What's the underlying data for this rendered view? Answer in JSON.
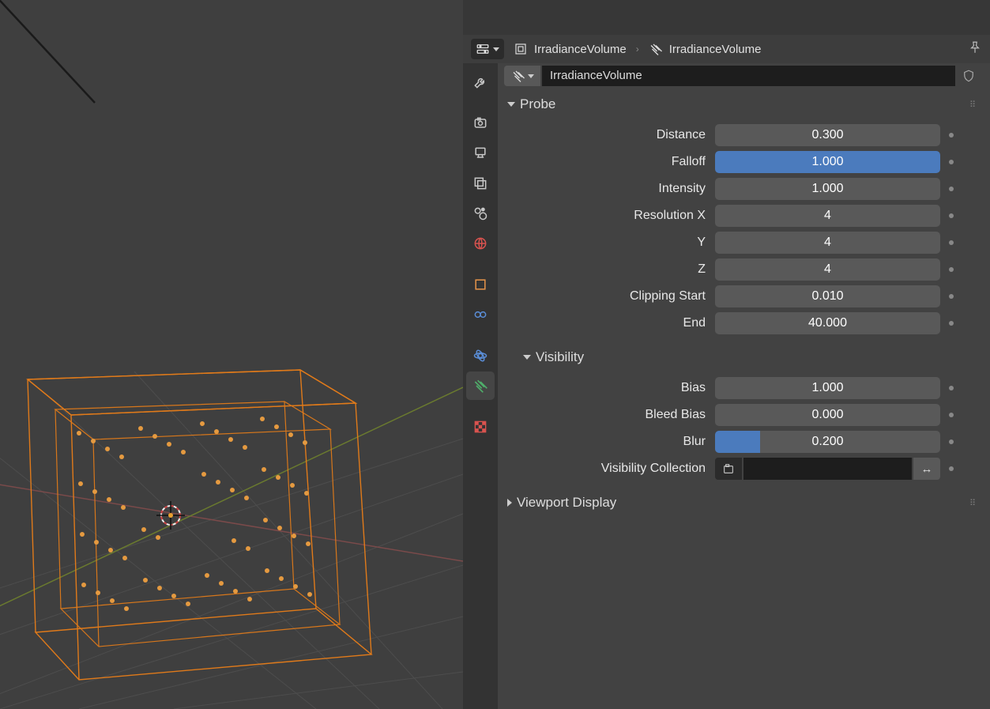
{
  "breadcrumb": {
    "object_name": "IrradianceVolume",
    "data_name": "IrradianceVolume"
  },
  "datablock": {
    "name": "IrradianceVolume"
  },
  "panel_probe": {
    "title": "Probe",
    "distance": {
      "label": "Distance",
      "value": "0.300"
    },
    "falloff": {
      "label": "Falloff",
      "value": "1.000"
    },
    "intensity": {
      "label": "Intensity",
      "value": "1.000"
    },
    "res_x": {
      "label": "Resolution X",
      "value": "4"
    },
    "res_y": {
      "label": "Y",
      "value": "4"
    },
    "res_z": {
      "label": "Z",
      "value": "4"
    },
    "clip_start": {
      "label": "Clipping Start",
      "value": "0.010"
    },
    "clip_end": {
      "label": "End",
      "value": "40.000"
    }
  },
  "panel_visibility": {
    "title": "Visibility",
    "bias": {
      "label": "Bias",
      "value": "1.000"
    },
    "bleed_bias": {
      "label": "Bleed Bias",
      "value": "0.000"
    },
    "blur": {
      "label": "Blur",
      "value": "0.200"
    },
    "collection": {
      "label": "Visibility Collection"
    }
  },
  "panel_viewport": {
    "title": "Viewport Display"
  }
}
